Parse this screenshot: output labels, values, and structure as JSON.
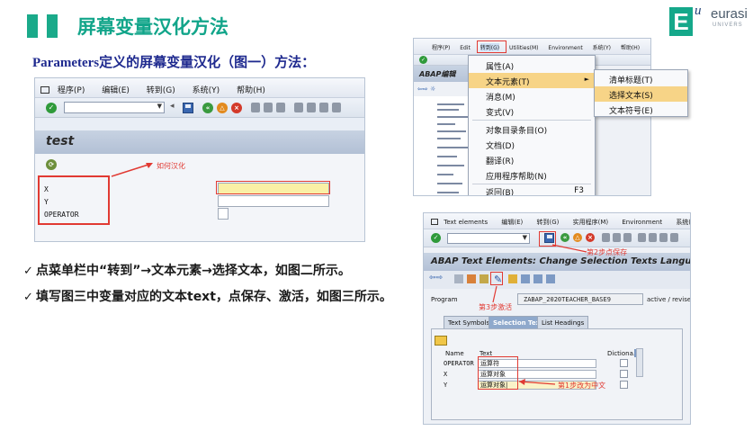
{
  "slide": {
    "title": "屏幕变量汉化方法",
    "subtitle": "Parameters定义的屏幕变量汉化（图一）方法：",
    "logo": {
      "letter": "E",
      "u": "u",
      "name": "eurasi",
      "sub": "UNIVERS"
    },
    "bullets": [
      {
        "mark": "✓",
        "text": "点菜单栏中“转到”→文本元素→选择文本，如图二所示。"
      },
      {
        "mark": "✓",
        "text": "填写图三中变量对应的文本text，点保存、激活，如图三所示。"
      }
    ]
  },
  "fig1": {
    "menu": [
      "程序(P)",
      "编辑(E)",
      "转到(G)",
      "系统(Y)",
      "帮助(H)"
    ],
    "screen_title": "test",
    "annotation": "如何汉化",
    "fields": [
      "X",
      "Y",
      "OPERATOR"
    ]
  },
  "fig2": {
    "menu": [
      "程序(P)",
      "Edit",
      "转到(G)",
      "Utilities(M)",
      "Environment",
      "系统(Y)",
      "帮助(H)"
    ],
    "screen_title": "ABAP编辑",
    "dropdown": [
      {
        "label": "属性(A)",
        "shortcut": "",
        "arrow": ""
      },
      {
        "label": "文本元素(T)",
        "shortcut": "",
        "arrow": "►"
      },
      {
        "label": "消息(M)",
        "shortcut": "",
        "arrow": ""
      },
      {
        "label": "变式(V)",
        "shortcut": "",
        "arrow": ""
      },
      {
        "label": "对象目录条目(O)",
        "shortcut": "",
        "arrow": ""
      },
      {
        "label": "文档(D)",
        "shortcut": "",
        "arrow": ""
      },
      {
        "label": "翻译(R)",
        "shortcut": "",
        "arrow": ""
      },
      {
        "label": "应用程序帮助(N)",
        "shortcut": "",
        "arrow": ""
      },
      {
        "label": "返回(B)",
        "shortcut": "F3",
        "arrow": ""
      }
    ],
    "submenu": [
      "清单标题(T)",
      "选择文本(S)",
      "文本符号(E)"
    ]
  },
  "fig3": {
    "menu": [
      "Text elements",
      "编辑(E)",
      "转到(G)",
      "实用程序(M)",
      "Environment",
      "系统(Y)"
    ],
    "screen_title": "ABAP Text Elements: Change Selection Texts Langua",
    "annotation_save": "第2步点保存",
    "annotation_activate": "第3步激活",
    "annotation_edit": "第1步改为中文",
    "program_label": "Program",
    "program_value": "ZABAP_2020TEACHER_BASE9",
    "program_status": "active / revised",
    "tabs": [
      "Text Symbols",
      "Selection Texts",
      "List Headings"
    ],
    "active_tab": "Selection Texts",
    "table_headers": {
      "name": "Name",
      "text": "Text",
      "dictionary": "Dictiona..."
    },
    "rows": [
      {
        "name": "OPERATOR",
        "text": "运算符"
      },
      {
        "name": "X",
        "text": "运算对象"
      },
      {
        "name": "Y",
        "text": "运算对象|"
      }
    ]
  },
  "colors": {
    "accent": "#12a58a",
    "subtitle": "#1f2a8f",
    "annotation": "#e13a33",
    "highlight": "#f7d487"
  }
}
